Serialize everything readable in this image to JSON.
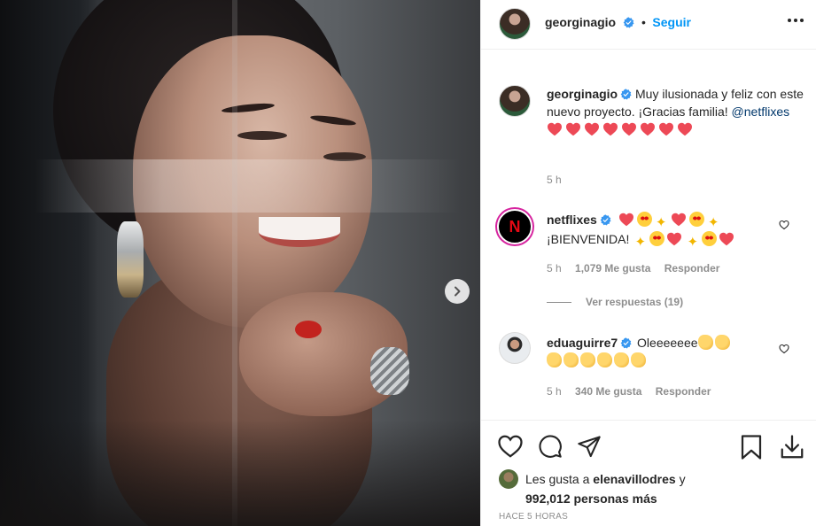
{
  "post": {
    "author": "georginagio",
    "follow_label": "Seguir",
    "dot": "•",
    "more_label": "..."
  },
  "caption": {
    "username": "georginagio",
    "text": "Muy ilusionada y feliz con este nuevo proyecto. ¡Gracias familia!",
    "mention": "@netflixes",
    "time": "5 h",
    "hearts": 8
  },
  "comments": [
    {
      "username": "netflixes",
      "avatar_letter": "N",
      "text": "¡BIENVENIDA!",
      "time": "5 h",
      "likes": "1,079 Me gusta",
      "reply_label": "Responder",
      "replies_label": "Ver respuestas (19)"
    },
    {
      "username": "eduaguirre7",
      "text": "Oleeeeeee",
      "time": "5 h",
      "likes": "340 Me gusta",
      "reply_label": "Responder"
    }
  ],
  "likes": {
    "prefix": "Les gusta a",
    "user": "elenavillodres",
    "and": "y",
    "others": "992,012 personas más"
  },
  "posted": "HACE 5 HORAS",
  "colors": {
    "accent_blue": "#0095f6",
    "heart_red": "#ed4956",
    "verified_blue": "#3897f0",
    "text": "#262626",
    "meta": "#8e8e8e"
  },
  "icons": [
    "verified-badge-icon",
    "more-options-icon",
    "next-arrow-icon",
    "heart-icon",
    "comment-icon",
    "share-icon",
    "bookmark-icon",
    "download-icon"
  ]
}
